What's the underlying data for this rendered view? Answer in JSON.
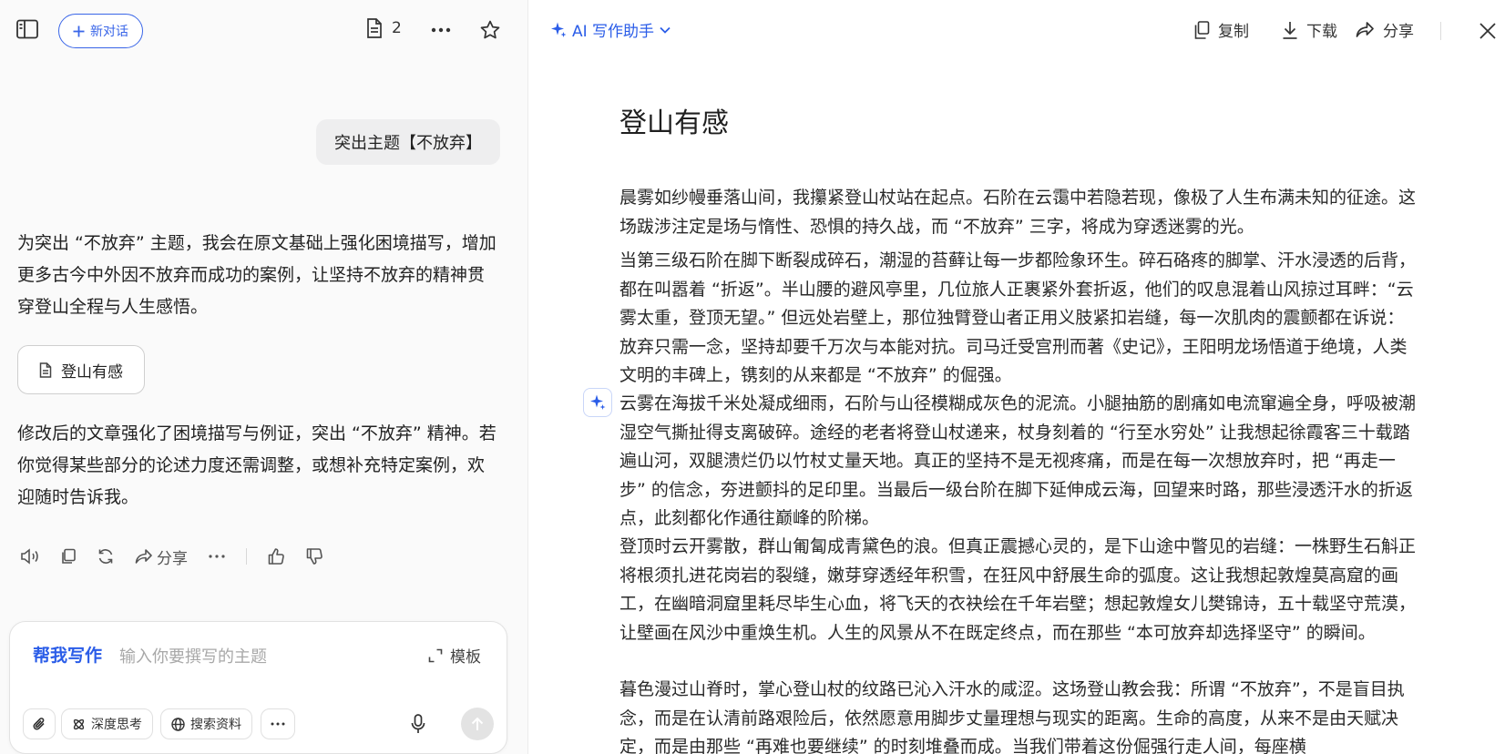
{
  "left": {
    "header": {
      "new_chat_label": "新对话",
      "doc_count": "2"
    },
    "user_message": "突出主题【不放弃】",
    "assistant_reply_1": "为突出 “不放弃” 主题，我会在原文基础上强化困境描写，增加更多古今中外因不放弃而成功的案例，让坚持不放弃的精神贯穿登山全程与人生感悟。",
    "doc_card_label": "登山有感",
    "assistant_reply_2": "修改后的文章强化了困境描写与例证，突出 “不放弃” 精神。若你觉得某些部分的论述力度还需调整，或想补充特定案例，欢迎随时告诉我。",
    "actions": {
      "share_label": "分享"
    },
    "composer": {
      "mode_label": "帮我写作",
      "placeholder": "输入你要撰写的主题",
      "template_label": "模板",
      "deep_think_label": "深度思考",
      "search_label": "搜索资料"
    }
  },
  "right": {
    "header": {
      "title": "AI 写作助手",
      "copy_label": "复制",
      "download_label": "下载",
      "share_label": "分享"
    },
    "document": {
      "title": "登山有感",
      "paragraphs": [
        "晨雾如纱幔垂落山间，我攥紧登山杖站在起点。石阶在云霭中若隐若现，像极了人生布满未知的征途。这场跋涉注定是场与惰性、恐惧的持久战，而 “不放弃” 三字，将成为穿透迷雾的光。",
        "当第三级石阶在脚下断裂成碎石，潮湿的苔藓让每一步都险象环生。碎石硌疼的脚掌、汗水浸透的后背，都在叫嚣着 “折返”。半山腰的避风亭里，几位旅人正裹紧外套折返，他们的叹息混着山风掠过耳畔：“云雾太重，登顶无望。” 但远处岩壁上，那位独臂登山者正用义肢紧扣岩缝，每一次肌肉的震颤都在诉说：放弃只需一念，坚持却要千万次与本能对抗。司马迁受宫刑而著《史记》，王阳明龙场悟道于绝境，人类文明的丰碑上，镌刻的从来都是 “不放弃” 的倔强。",
        "云雾在海拔千米处凝成细雨，石阶与山径模糊成灰色的泥流。小腿抽筋的剧痛如电流窜遍全身，呼吸被潮湿空气撕扯得支离破碎。途经的老者将登山杖递来，杖身刻着的 “行至水穷处” 让我想起徐霞客三十载踏遍山河，双腿溃烂仍以竹杖丈量天地。真正的坚持不是无视疼痛，而是在每一次想放弃时，把 “再走一步” 的信念，夯进颤抖的足印里。当最后一级台阶在脚下延伸成云海，回望来时路，那些浸透汗水的折返点，此刻都化作通往巅峰的阶梯。",
        "登顶时云开雾散，群山匍匐成青黛色的浪。但真正震撼心灵的，是下山途中瞥见的岩缝：一株野生石斛正将根须扎进花岗岩的裂缝，嫩芽穿透经年积雪，在狂风中舒展生命的弧度。这让我想起敦煌莫高窟的画工，在幽暗洞窟里耗尽毕生心血，将飞天的衣袂绘在千年岩壁；想起敦煌女儿樊锦诗，五十载坚守荒漠，让壁画在风沙中重焕生机。人生的风景从不在既定终点，而在那些 “本可放弃却选择坚守” 的瞬间。",
        "暮色漫过山脊时，掌心登山杖的纹路已沁入汗水的咸涩。这场登山教会我：所谓 “不放弃”，不是盲目执念，而是在认清前路艰险后，依然愿意用脚步丈量理想与现实的距离。生命的高度，从来不是由天赋决定，而是由那些 “再难也要继续” 的时刻堆叠而成。当我们带着这份倔强行走人间，每座横"
      ]
    }
  }
}
